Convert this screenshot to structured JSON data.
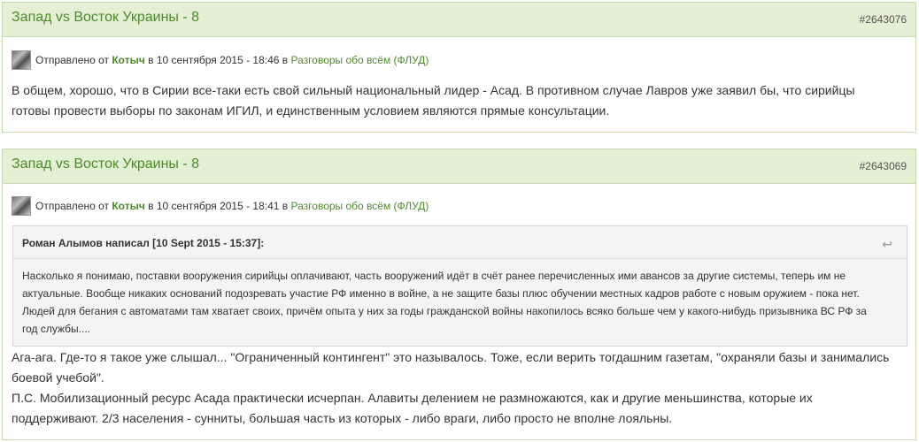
{
  "posts": [
    {
      "title": "Запад vs Восток Украины - 8",
      "id": "#2643076",
      "meta": {
        "prefix": "Отправлено от",
        "author": "Котыч",
        "date": "в 10 сентября 2015 - 18:46 в",
        "forum": "Разговоры обо всём (ФЛУД)"
      },
      "lines": [
        "В общем, хорошо, что в Сирии все-таки есть свой сильный национальный лидер - Асад. В противном случае Лавров уже заявил бы, что сирийцы",
        "готовы провести выборы по законам ИГИЛ, и единственным условием являются прямые консультации."
      ]
    },
    {
      "title": "Запад vs Восток Украины - 8",
      "id": "#2643069",
      "meta": {
        "prefix": "Отправлено от",
        "author": "Котыч",
        "date": "в 10 сентября 2015 - 18:41 в",
        "forum": "Разговоры обо всём (ФЛУД)"
      },
      "quote": {
        "author": "Роман Алымов написал [10 Sept 2015 - 15:37]:",
        "icon": "reply-arrow-icon",
        "lines": [
          "Насколько я понимаю, поставки вооружения сирийцы оплачивают, часть вооружений идёт в счёт ранее перечисленных ими авансов за другие системы, теперь им не",
          "актуальные. Вообще никаких оснований подозревать участие РФ именно в войне, а не защите базы плюс обучении местных кадров работе с новым оружием - пока нет.",
          "Людей для бегания с автоматами там хватает своих, причём опыта у них за годы гражданской войны накопилось всяко больше чем у какого-нибудь призывника ВС РФ за",
          "год службы...."
        ]
      },
      "lines": [
        "Ага-ага. Где-то я такое уже слышал... \"Ограниченный контингент\" это называлось. Тоже, если верить тогдашним газетам, \"охраняли базы и занимались",
        "боевой учебой\".",
        "П.С. Мобилизационный ресурс Асада практически исчерпан. Алавиты делением не размножаются, как и другие меньшинства, которые их",
        "поддерживают. 2/3 населения - сунниты, большая часть из которых - либо враги, либо просто не вполне лояльны."
      ]
    }
  ],
  "colors": {
    "header_bg": "#e3f0d4",
    "link": "#4f8a2a",
    "border": "#c5ddb0"
  }
}
